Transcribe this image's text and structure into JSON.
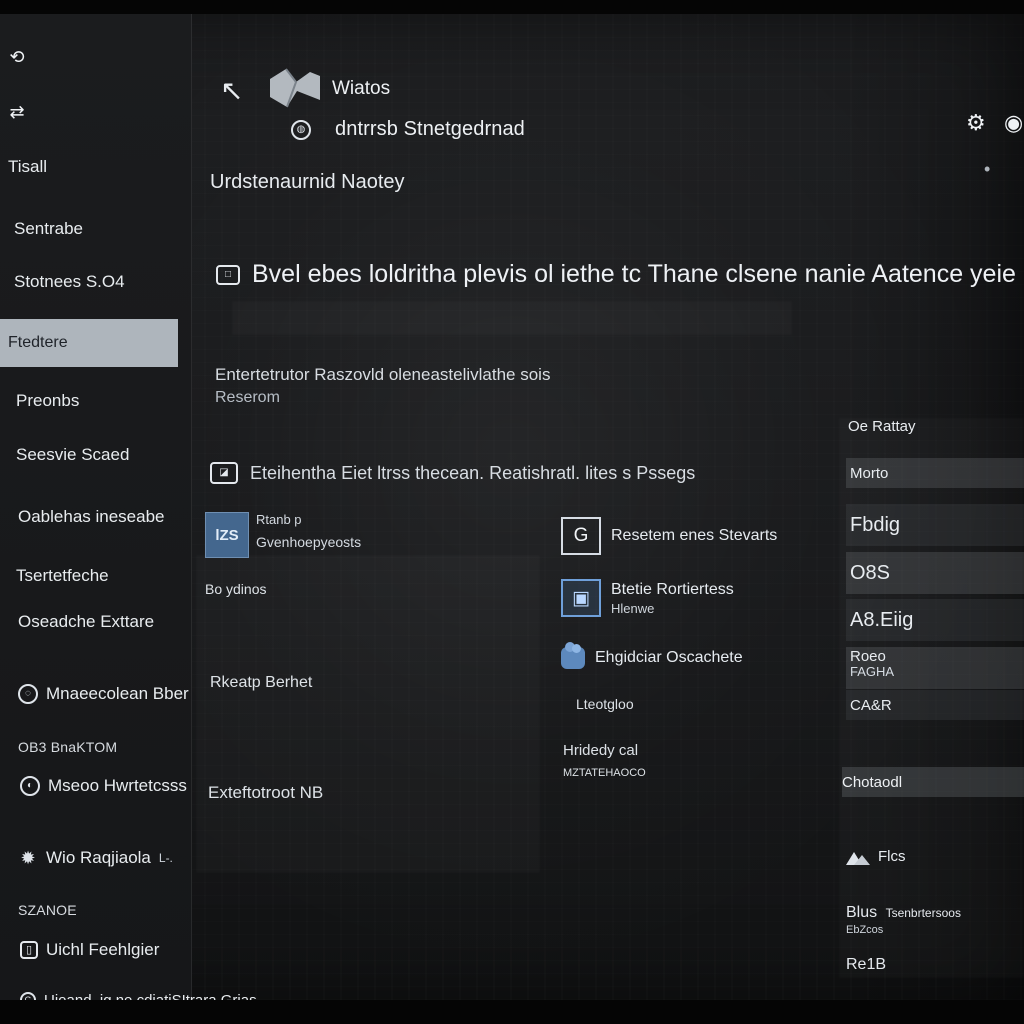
{
  "sidebar": {
    "top_icons": [
      "link-icon",
      "unlink-icon"
    ],
    "items": [
      {
        "label": "Tisall",
        "icon": ""
      },
      {
        "label": "Sentrabe",
        "icon": ""
      },
      {
        "label": "Stotnees S.O4",
        "icon": ""
      },
      {
        "label": "Ftedtere",
        "icon": "",
        "active": true
      },
      {
        "label": "Preonbs",
        "icon": ""
      },
      {
        "label": "Seesvie Scaed",
        "icon": ""
      },
      {
        "label": "Oablehas ineseabe",
        "icon": ""
      },
      {
        "label": "Tsertetfeche",
        "icon": ""
      },
      {
        "label": "Oseadche Exttare",
        "icon": ""
      },
      {
        "label": "Mnaeecolean Bber",
        "icon": "user-icon"
      },
      {
        "label": "Mseoo Hwrtetcsss",
        "icon": "globe-icon"
      },
      {
        "label": "Wio Raqjiaola",
        "icon": "gear-icon",
        "suffix": "L-."
      },
      {
        "label": "Uichl Feehlgier",
        "icon": "phone-icon"
      },
      {
        "label": "Uioand  ,ig  ne.cdiatiSItrara  Grias",
        "icon": "g-icon"
      }
    ],
    "labels": [
      "OB3 BnaKTOM",
      "SZANOE"
    ]
  },
  "header": {
    "title": "Wiatos",
    "user_name": "dntrrsb Stnetgedrnad",
    "back_icon": "back-arrow-icon",
    "logo_icon": "app-logo-icon",
    "avatar_icon": "user-circle-icon",
    "right_icon_1": "settings-icon",
    "right_icon_2": "visibility-icon",
    "dot": "•"
  },
  "main": {
    "page_title": "Urdstenaurnid Naotey",
    "large_row_text": "Bvel ebes loldritha plevis ol iethe tc Thane clsene nanie Aatence yeie",
    "note_line1": "Entertetrutor Raszovld oleneastelivlathe sois",
    "note_line2": "Reserom",
    "medium_row_text": "Eteihentha Eiet ltrss thecean. Reatishratl. lites s Pssegs",
    "left_card": {
      "icon_text": "lZS",
      "title": "Rtanb p",
      "subtitle": "Gvenhoepyeosts"
    },
    "left_small_1": "Bo ydinos",
    "left_small_2": "Rkeatp Berhet",
    "left_small_3": "Exteftotroot  NB",
    "mid_items": [
      {
        "primary": "Resetem enes Stevarts",
        "secondary": "",
        "icon": "square-g-icon"
      },
      {
        "primary": "Btetie Rortiertess",
        "secondary": "Hlenwe",
        "icon": "square-frame-icon"
      },
      {
        "primary": "Ehgidciar Oscachete",
        "secondary": "",
        "icon": "cloud-icon"
      }
    ],
    "mid_small_1": "Lteotgloo",
    "mid_small_2": "Hridedy cal",
    "mid_small_3": "MZTATEHAOCO"
  },
  "right_panel": {
    "title": "Oe Rattay",
    "rows": [
      {
        "text": "Morto",
        "style": "normal"
      },
      {
        "text": "Fbdig",
        "style": "large"
      },
      {
        "text": "O8S",
        "style": "large"
      },
      {
        "text": "A8.Eiig",
        "style": "large"
      },
      {
        "line1": "Roeo",
        "line2": "FAGHA",
        "style": "double"
      },
      {
        "text": "CA&R",
        "style": "normal"
      }
    ],
    "button": "Chotaodl",
    "image_row_text": "Flcs",
    "bottom_rows": [
      {
        "line1": "Blus",
        "line2": "Tsenbrtersoos",
        "line3": "EbZcos"
      },
      {
        "line1": "Re1B",
        "line2": ""
      }
    ]
  }
}
